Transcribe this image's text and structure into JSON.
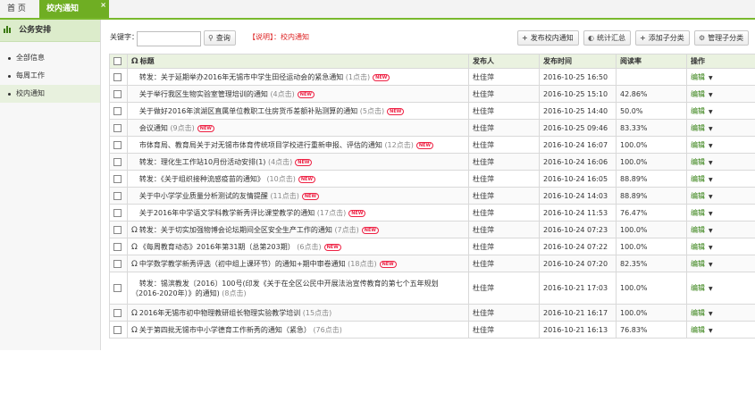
{
  "tabs": {
    "home": "首 页",
    "active": "校内通知",
    "close": "×"
  },
  "sidebar": {
    "title": "公务安排",
    "items": [
      {
        "label": "全部信息"
      },
      {
        "label": "每周工作"
      },
      {
        "label": "校内通知"
      }
    ]
  },
  "toolbar": {
    "keyword_label": "关键字：",
    "keyword_value": "",
    "search_label": "查询",
    "note": "【说明】：校内通知",
    "publish_label": "发布校内通知",
    "stats_label": "统计汇总",
    "add_category_label": "添加子分类",
    "manage_category_label": "管理子分类"
  },
  "table": {
    "headers": {
      "title": "标题",
      "publisher": "发布人",
      "time": "发布时间",
      "rate": "阅读率",
      "action": "操作"
    },
    "rows": [
      {
        "attach": false,
        "title": "转发：关于延期举办2016年无锡市中学生田径运动会的紧急通知",
        "clicks": "(1点击)",
        "new": "NEW",
        "publisher": "杜佳萍",
        "time": "2016-10-25 16:50",
        "rate": "",
        "action": "编辑"
      },
      {
        "attach": false,
        "title": "关于举行我区生物实验室管理培训的通知",
        "clicks": "(4点击)",
        "new": "NEW",
        "publisher": "杜佳萍",
        "time": "2016-10-25 15:10",
        "rate": "42.86%",
        "action": "编辑"
      },
      {
        "attach": false,
        "title": "关于做好2016年滨湖区直属单位教职工住房货币差额补贴测算的通知",
        "clicks": "(5点击)",
        "new": "NEW",
        "publisher": "杜佳萍",
        "time": "2016-10-25 14:40",
        "rate": "50.0%",
        "action": "编辑"
      },
      {
        "attach": false,
        "title": "会议通知",
        "clicks": "(9点击)",
        "new": "NEW",
        "publisher": "杜佳萍",
        "time": "2016-10-25 09:46",
        "rate": "83.33%",
        "action": "编辑"
      },
      {
        "attach": false,
        "title": "市体育局、教育局关于对无锡市体育传统项目学校进行重新申报、评估的通知",
        "clicks": "(12点击)",
        "new": "NEW",
        "publisher": "杜佳萍",
        "time": "2016-10-24 16:07",
        "rate": "100.0%",
        "action": "编辑"
      },
      {
        "attach": false,
        "title": "转发：理化生工作站10月份活动安排(1)",
        "clicks": "(4点击)",
        "new": "NEW",
        "publisher": "杜佳萍",
        "time": "2016-10-24 16:06",
        "rate": "100.0%",
        "action": "编辑"
      },
      {
        "attach": false,
        "title": "转发：《关于组织接种流感疫苗的通知》",
        "clicks": "(10点击)",
        "new": "NEW",
        "publisher": "杜佳萍",
        "time": "2016-10-24 16:05",
        "rate": "88.89%",
        "action": "编辑"
      },
      {
        "attach": false,
        "title": "关于中小学学业质量分析测试的友情提醒",
        "clicks": "(11点击)",
        "new": "NEW",
        "publisher": "杜佳萍",
        "time": "2016-10-24 14:03",
        "rate": "88.89%",
        "action": "编辑"
      },
      {
        "attach": false,
        "title": "关于2016年中学语文学科教学新秀评比课堂教学的通知",
        "clicks": "(17点击)",
        "new": "NEW",
        "publisher": "杜佳萍",
        "time": "2016-10-24 11:53",
        "rate": "76.47%",
        "action": "编辑"
      },
      {
        "attach": true,
        "title": "转发：关于切实加强物博会论坛期间全区安全生产工作的通知",
        "clicks": "(7点击)",
        "new": "NEW",
        "publisher": "杜佳萍",
        "time": "2016-10-24 07:23",
        "rate": "100.0%",
        "action": "编辑"
      },
      {
        "attach": true,
        "title": "《每周教育动态》2016年第31期（总第203期）",
        "clicks": "(6点击)",
        "new": "NEW",
        "publisher": "杜佳萍",
        "time": "2016-10-24 07:22",
        "rate": "100.0%",
        "action": "编辑"
      },
      {
        "attach": true,
        "title": "中学数学教学新秀评选（初中组上课环节）的通知+期中审卷通知",
        "clicks": "(18点击)",
        "new": "NEW",
        "publisher": "杜佳萍",
        "time": "2016-10-24 07:20",
        "rate": "82.35%",
        "action": "编辑"
      },
      {
        "attach": false,
        "title": "转发：锡滨教发〔2016〕100号(印发《关于在全区公民中开展法治宣传教育的第七个五年规划（2016-2020年）》的通知)",
        "clicks": "(8点击)",
        "new": "",
        "publisher": "杜佳萍",
        "time": "2016-10-21 17:03",
        "rate": "100.0%",
        "action": "编辑",
        "tall": true
      },
      {
        "attach": true,
        "title": "2016年无锡市初中物理教研组长物理实验教学培训",
        "clicks": "(15点击)",
        "new": "",
        "publisher": "杜佳萍",
        "time": "2016-10-21 16:17",
        "rate": "100.0%",
        "action": "编辑"
      },
      {
        "attach": true,
        "title": "关于第四批无锡市中小学德育工作新秀的通知（紧急）",
        "clicks": "(76点击)",
        "new": "",
        "publisher": "杜佳萍",
        "time": "2016-10-21 16:13",
        "rate": "76.83%",
        "action": "编辑"
      }
    ]
  }
}
